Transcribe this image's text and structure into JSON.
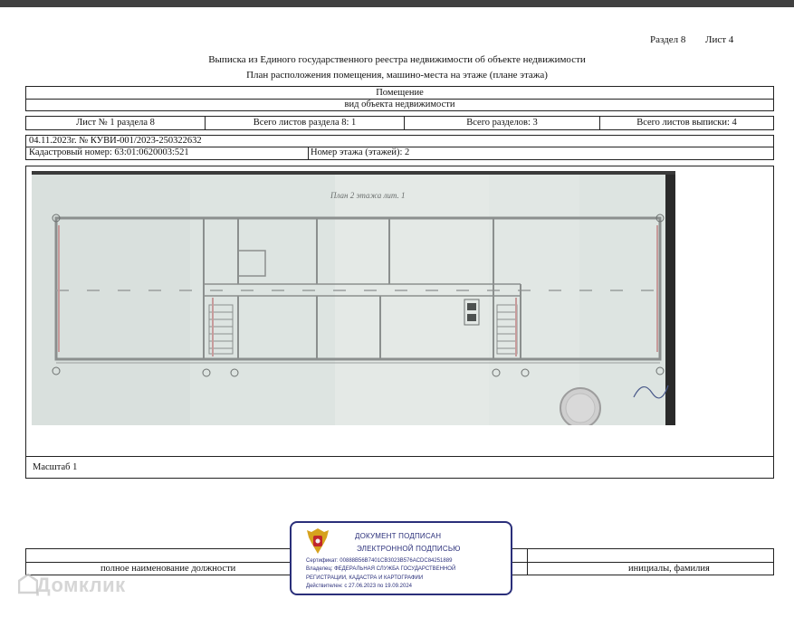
{
  "header": {
    "section": "Раздел 8",
    "sheet": "Лист 4",
    "title": "Выписка из Единого государственного реестра недвижимости об объекте недвижимости",
    "subtitle": "План расположения помещения, машино-места на этаже (плане этажа)"
  },
  "object": {
    "type_value": "Помещение",
    "type_caption": "вид объекта недвижимости"
  },
  "sheet_info": {
    "sheet_of_section": "Лист № 1 раздела 8",
    "total_sheets_section": "Всего листов раздела 8: 1",
    "total_sections": "Всего разделов: 3",
    "total_sheets_extract": "Всего листов выписки: 4"
  },
  "record": {
    "date_number": "04.11.2023г. № КУВИ-001/2023-250322632",
    "cadastral": "Кадастровый номер: 63:01:0620003:521",
    "floor": "Номер этажа (этажей): 2"
  },
  "plan": {
    "title": "План 2 этажа лит. 1"
  },
  "scale": {
    "label": "Масштаб 1"
  },
  "signature": {
    "position_caption": "полное наименование должности",
    "name_caption": "инициалы, фамилия"
  },
  "stamp": {
    "line1": "ДОКУМЕНТ ПОДПИСАН",
    "line2": "ЭЛЕКТРОННОЙ ПОДПИСЬЮ",
    "certificate": "Сертификат: 00888B56B7401CB3023B576ACDC84251889",
    "owner1": "Владелец: ФЕДЕРАЛЬНАЯ СЛУЖБА ГОСУДАРСТВЕННОЙ",
    "owner2": "РЕГИСТРАЦИИ, КАДАСТРА И КАРТОГРАФИИ",
    "valid": "Действителен: с 27.06.2023 по 19.09.2024"
  },
  "watermark": {
    "text": "Домклик"
  }
}
